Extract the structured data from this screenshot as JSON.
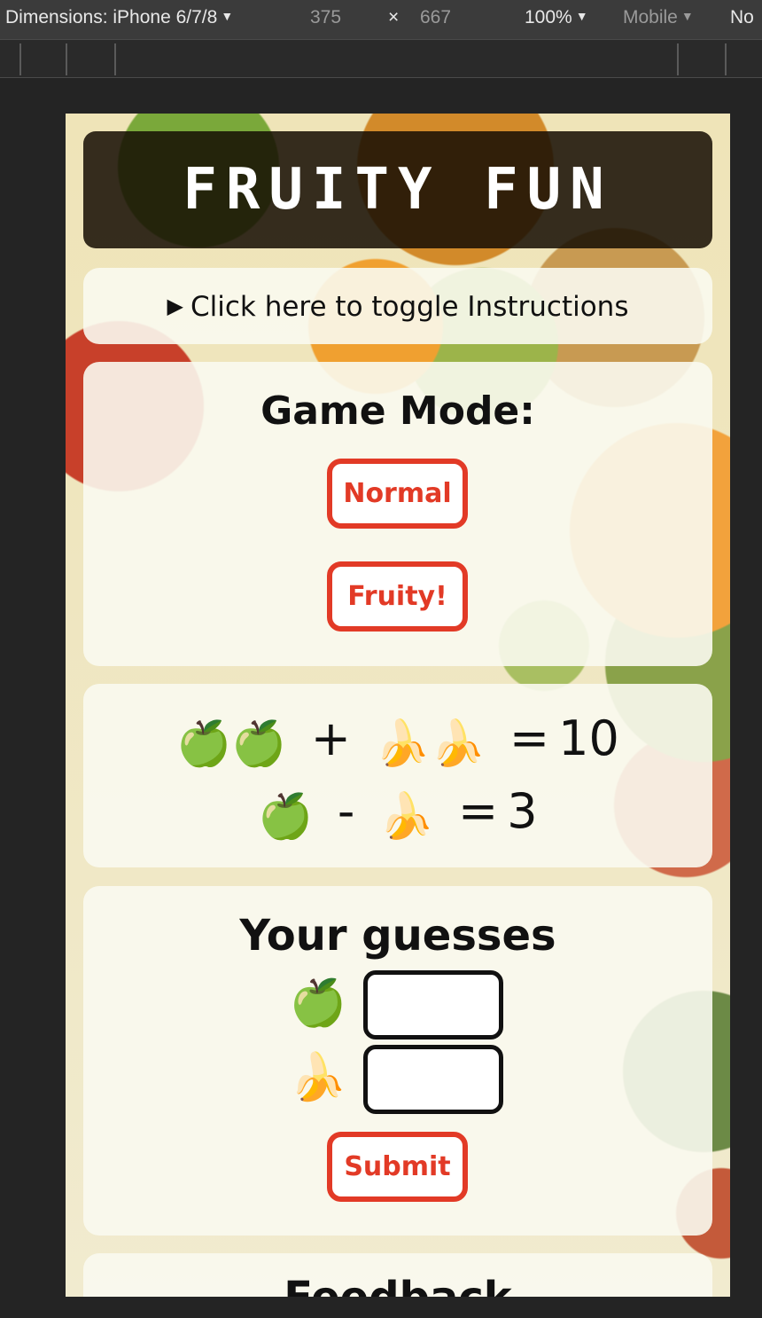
{
  "devtools": {
    "dimensions_label": "Dimensions: iPhone 6/7/8",
    "width": "375",
    "times": "×",
    "height": "667",
    "zoom": "100%",
    "throttle": "Mobile",
    "more": "No",
    "caret": "▼"
  },
  "app": {
    "title": "FRUITY FUN",
    "instructions_arrow": "▶",
    "instructions_toggle": "Click here to toggle Instructions",
    "game_mode": {
      "heading": "Game Mode:",
      "normal_label": "Normal",
      "fruity_label": "Fruity!"
    },
    "equations": {
      "line1": {
        "left": [
          "🍏",
          "🍏"
        ],
        "op": "+",
        "right": [
          "🍌",
          "🍌"
        ],
        "equals": "=",
        "result": "10"
      },
      "line2": {
        "left": [
          "🍏"
        ],
        "op": "-",
        "right": [
          "🍌"
        ],
        "equals": "=",
        "result": "3"
      }
    },
    "guesses": {
      "heading": "Your guesses",
      "apple_emoji": "🍏",
      "banana_emoji": "🍌",
      "apple_value": "",
      "banana_value": "",
      "submit_label": "Submit"
    },
    "feedback": {
      "heading": "Feedback"
    }
  },
  "colors": {
    "accent": "#e23a26",
    "title_bg": "#160e04",
    "panel_bg": "#faf9f0"
  }
}
